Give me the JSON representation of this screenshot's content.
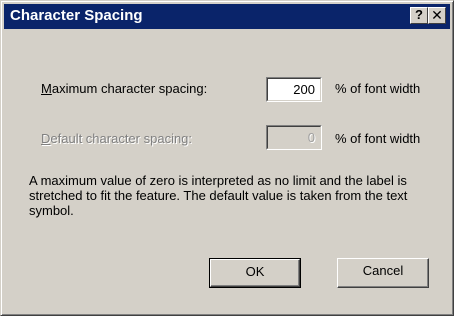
{
  "window": {
    "title": "Character Spacing",
    "help_glyph": "?",
    "close_glyph": "✕"
  },
  "max_spacing": {
    "label_accel": "M",
    "label_rest": "aximum character spacing:",
    "value": "200",
    "unit": "% of font width"
  },
  "default_spacing": {
    "label_accel": "D",
    "label_rest": "efault character spacing:",
    "value": "0",
    "unit": "% of font width"
  },
  "description": "A maximum value of zero is interpreted as no limit and the label is stretched to fit the feature. The default value is taken from the text symbol.",
  "buttons": {
    "ok": "OK",
    "cancel": "Cancel"
  },
  "colors": {
    "titlebar": "#0a246a",
    "dialog_face": "#d4d0c8"
  }
}
